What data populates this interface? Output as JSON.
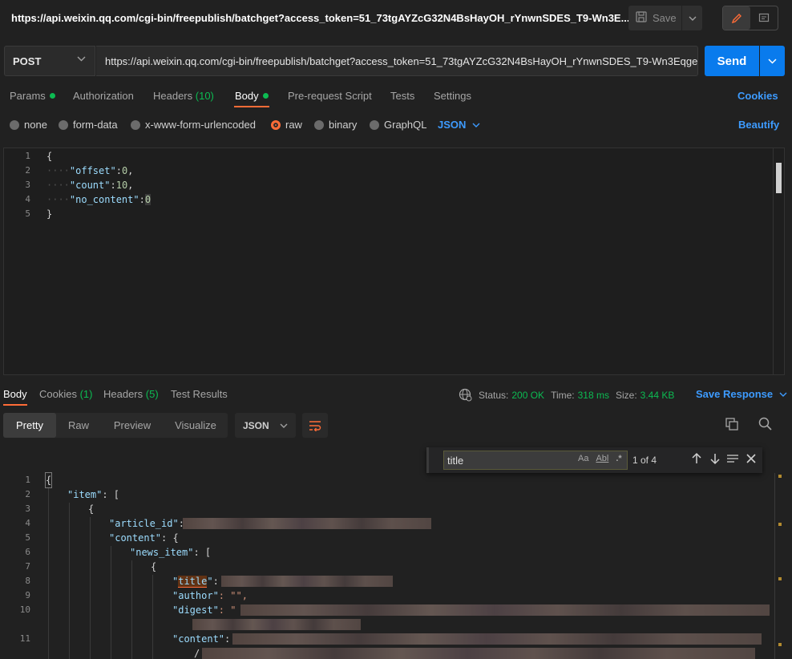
{
  "title_bar": {
    "request_title": "https://api.weixin.qq.com/cgi-bin/freepublish/batchget?access_token=51_73tgAYZcG32N4BsHayOH_rYnwnSDES_T9-Wn3E...",
    "save_label": "Save"
  },
  "request": {
    "method": "POST",
    "url": "https://api.weixin.qq.com/cgi-bin/freepublish/batchget?access_token=51_73tgAYZcG32N4BsHayOH_rYnwnSDES_T9-Wn3Eqge...",
    "send_label": "Send"
  },
  "request_tabs": {
    "params": "Params",
    "authorization": "Authorization",
    "headers": "Headers",
    "headers_count": "(10)",
    "body": "Body",
    "pre_request": "Pre-request Script",
    "tests": "Tests",
    "settings": "Settings",
    "cookies": "Cookies"
  },
  "body_types": {
    "none": "none",
    "form_data": "form-data",
    "urlencoded": "x-www-form-urlencoded",
    "raw": "raw",
    "binary": "binary",
    "graphql": "GraphQL",
    "selected_format": "JSON",
    "beautify": "Beautify"
  },
  "request_body": {
    "line_numbers": [
      "1",
      "2",
      "3",
      "4",
      "5"
    ],
    "open_brace": "{",
    "close_brace": "}",
    "offset_key": "\"offset\"",
    "offset_value": "0",
    "count_key": "\"count\"",
    "count_value": "10",
    "no_content_key": "\"no_content\"",
    "no_content_value": "0"
  },
  "response_tabs": {
    "body": "Body",
    "cookies": "Cookies",
    "cookies_count": "(1)",
    "headers": "Headers",
    "headers_count": "(5)",
    "test_results": "Test Results"
  },
  "response_status": {
    "status_label": "Status:",
    "status_value": "200 OK",
    "time_label": "Time:",
    "time_value": "318 ms",
    "size_label": "Size:",
    "size_value": "3.44 KB",
    "save_response": "Save Response"
  },
  "response_view": {
    "pretty": "Pretty",
    "raw": "Raw",
    "preview": "Preview",
    "visualize": "Visualize",
    "format": "JSON"
  },
  "find_widget": {
    "query": "title",
    "match_case": "Aa",
    "whole_word": "Abl",
    "regex": ".*",
    "count": "1 of 4"
  },
  "response_body": {
    "line_numbers": [
      "1",
      "2",
      "3",
      "4",
      "5",
      "6",
      "7",
      "8",
      "9",
      "10",
      "11"
    ],
    "l1": "{",
    "l2_key": "\"item\"",
    "l2_rest": ": [",
    "l3": "{",
    "l4_key": "\"article_id\"",
    "l4_rest": ":",
    "l5_key": "\"content\"",
    "l5_rest": ": {",
    "l6_key": "\"news_item\"",
    "l6_rest": ": [",
    "l7": "{",
    "l8_key_q1": "\"",
    "l8_key_match": "title",
    "l8_key_q2": "\"",
    "l8_rest": ":",
    "l9_key": "\"author\"",
    "l9_rest": ": \"\",",
    "l10_key": "\"digest\"",
    "l10_rest": ": \"",
    "l11_key": "\"content\"",
    "l11_rest": ":",
    "l11_cont": "/"
  },
  "colors": {
    "accent_orange": "#ff6c37",
    "link_blue": "#3d9bff",
    "send_blue": "#097bed",
    "success_green": "#0cbb52"
  },
  "icons": [
    "save-icon",
    "chevron-down-icon",
    "pencil-icon",
    "comment-icon",
    "globe-icon",
    "copy-icon",
    "search-icon",
    "wrap-lines-icon",
    "arrow-up-icon",
    "arrow-down-icon",
    "selection-icon",
    "close-icon"
  ]
}
